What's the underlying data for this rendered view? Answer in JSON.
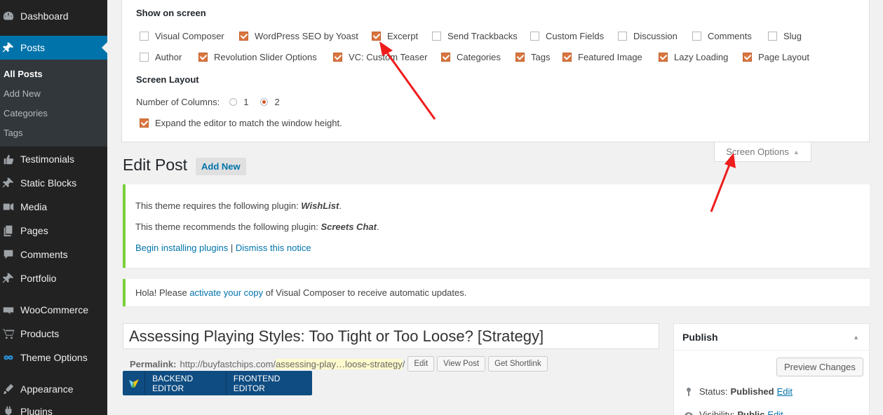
{
  "sidebar": {
    "menu": [
      {
        "label": "Dashboard",
        "icon": "dashboard-icon"
      },
      {
        "label": "Posts",
        "icon": "pin-icon"
      },
      {
        "label": "Testimonials",
        "icon": "thumbs-up-icon"
      },
      {
        "label": "Static Blocks",
        "icon": "pin-icon"
      },
      {
        "label": "Media",
        "icon": "media-icon"
      },
      {
        "label": "Pages",
        "icon": "pages-icon"
      },
      {
        "label": "Comments",
        "icon": "comment-icon"
      },
      {
        "label": "Portfolio",
        "icon": "pin-icon"
      },
      {
        "label": "WooCommerce",
        "icon": "woocommerce-icon"
      },
      {
        "label": "Products",
        "icon": "cart-icon"
      },
      {
        "label": "Theme Options",
        "icon": "infinity-icon"
      },
      {
        "label": "Appearance",
        "icon": "brush-icon"
      },
      {
        "label": "Plugins",
        "icon": "plugin-icon"
      }
    ],
    "submenu": [
      "All Posts",
      "Add New",
      "Categories",
      "Tags"
    ]
  },
  "screen_options": {
    "show_on_screen_heading": "Show on screen",
    "checkboxes": [
      {
        "label": "Visual Composer",
        "checked": false
      },
      {
        "label": "WordPress SEO by Yoast",
        "checked": true
      },
      {
        "label": "Excerpt",
        "checked": true
      },
      {
        "label": "Send Trackbacks",
        "checked": false
      },
      {
        "label": "Custom Fields",
        "checked": false
      },
      {
        "label": "Discussion",
        "checked": false
      },
      {
        "label": "Comments",
        "checked": false
      },
      {
        "label": "Slug",
        "checked": false
      },
      {
        "label": "Author",
        "checked": false
      },
      {
        "label": "Revolution Slider Options",
        "checked": true
      },
      {
        "label": "VC: Custom Teaser",
        "checked": true
      },
      {
        "label": "Categories",
        "checked": true
      },
      {
        "label": "Tags",
        "checked": true
      },
      {
        "label": "Featured Image",
        "checked": true
      },
      {
        "label": "Lazy Loading",
        "checked": true
      },
      {
        "label": "Page Layout",
        "checked": true
      }
    ],
    "layout_heading": "Screen Layout",
    "columns_label": "Number of Columns:",
    "column_options": [
      "1",
      "2"
    ],
    "selected_columns": "2",
    "expand_label": "Expand the editor to match the window height.",
    "expand_checked": true,
    "tab_label": "Screen Options"
  },
  "header": {
    "title": "Edit Post",
    "add_new": "Add New"
  },
  "notices": {
    "plugin_required_prefix": "This theme requires the following plugin: ",
    "plugin_required_name": "WishList",
    "plugin_recommended_prefix": "This theme recommends the following plugin: ",
    "plugin_recommended_name": "Screets Chat",
    "begin_installing": "Begin installing plugins",
    "separator": "|",
    "dismiss": "Dismiss this notice",
    "vc_prefix": "Hola! Please ",
    "vc_link": "activate your copy",
    "vc_suffix": " of Visual Composer to receive automatic updates."
  },
  "editor": {
    "post_title": "Assessing Playing Styles: Too Tight or Too Loose? [Strategy]",
    "permalink_label": "Permalink:",
    "permalink_base": "http://buyfastchips.com/",
    "permalink_slug": "assessing-play…loose-strategy",
    "permalink_trailing": "/",
    "edit_btn": "Edit",
    "view_post_btn": "View Post",
    "shortlink_btn": "Get Shortlink",
    "backend_editor": "BACKEND EDITOR",
    "frontend_editor": "FRONTEND EDITOR"
  },
  "publish": {
    "title": "Publish",
    "preview_btn": "Preview Changes",
    "status_label": "Status:",
    "status_value": "Published",
    "status_edit": "Edit",
    "visibility_label": "Visibility:",
    "visibility_value": "Public",
    "visibility_edit": "Edit"
  },
  "colors": {
    "sidebar_bg": "#222222",
    "active_menu": "#0073aa",
    "checkbox_checked": "#d9753f",
    "notice_border": "#7ad03a",
    "vc_bar": "#0f4c81",
    "annotation_arrow": "#ee1c1c"
  }
}
